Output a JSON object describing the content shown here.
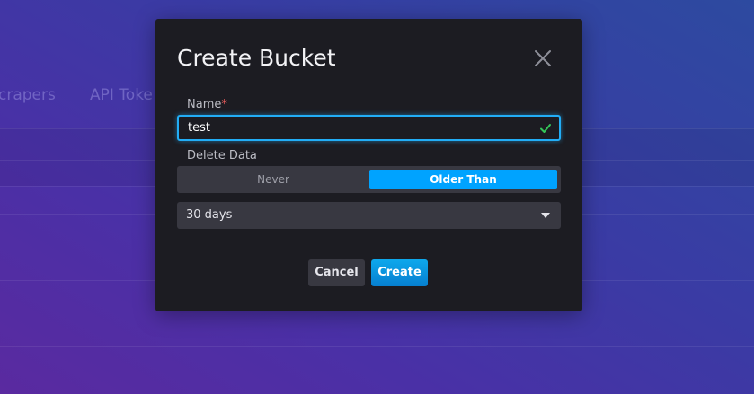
{
  "background": {
    "tabs": [
      {
        "label": "crapers"
      },
      {
        "label": "API Toke"
      }
    ]
  },
  "modal": {
    "title": "Create Bucket",
    "close_icon": "close-icon",
    "name_field": {
      "label": "Name",
      "required_marker": "*",
      "value": "test",
      "valid_icon": "check-icon"
    },
    "delete_data": {
      "label": "Delete Data",
      "options": [
        "Never",
        "Older Than"
      ],
      "selected": "Older Than"
    },
    "retention_select": {
      "value": "30 days",
      "caret_icon": "chevron-down-icon"
    },
    "buttons": {
      "cancel_label": "Cancel",
      "create_label": "Create"
    }
  },
  "colors": {
    "accent": "#00a3ff",
    "focus_border": "#22adf6",
    "valid_check": "#34c759",
    "modal_bg": "#1c1c22"
  }
}
